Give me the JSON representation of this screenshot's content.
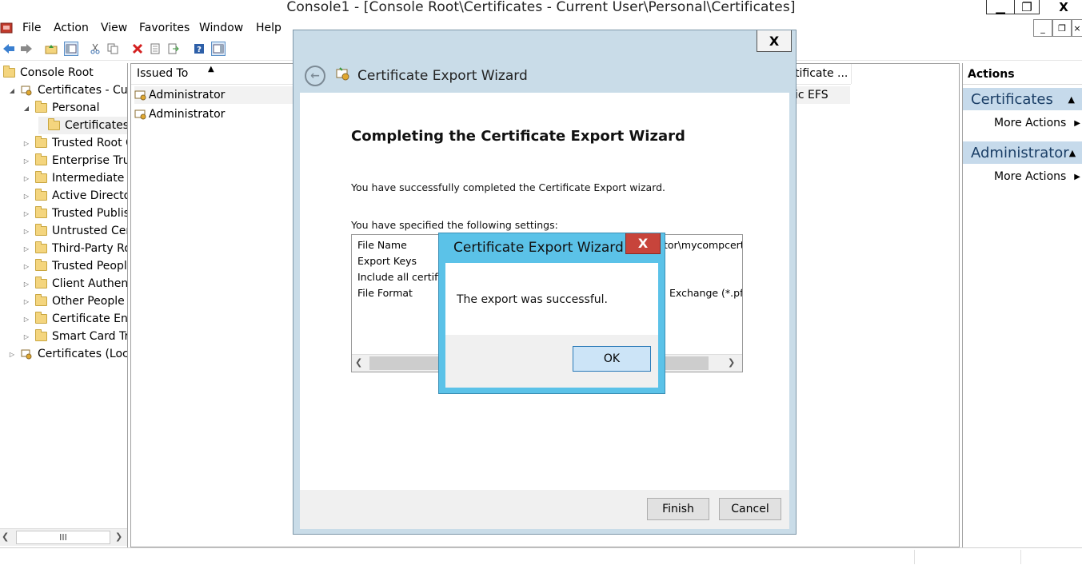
{
  "window": {
    "title": "Console1 - [Console Root\\Certificates - Current User\\Personal\\Certificates]",
    "minimize": "▁",
    "maximize": "❐",
    "close": "X"
  },
  "menu": {
    "items": [
      "File",
      "Action",
      "View",
      "Favorites",
      "Window",
      "Help"
    ],
    "mdi_minimize": "_",
    "mdi_restore": "❐",
    "mdi_close": "×"
  },
  "tree": {
    "items": [
      {
        "label": "Console Root",
        "level": 0,
        "arrow": "",
        "icon": "folder"
      },
      {
        "label": "Certificates - Curr",
        "level": 1,
        "arrow": "◢",
        "icon": "certstore"
      },
      {
        "label": "Personal",
        "level": 2,
        "arrow": "◢",
        "icon": "folder"
      },
      {
        "label": "Certificates",
        "level": 3,
        "arrow": "",
        "icon": "folder",
        "selected": true
      },
      {
        "label": "Trusted Root C",
        "level": 2,
        "arrow": "▷",
        "icon": "folder"
      },
      {
        "label": "Enterprise Trus",
        "level": 2,
        "arrow": "▷",
        "icon": "folder"
      },
      {
        "label": "Intermediate C",
        "level": 2,
        "arrow": "▷",
        "icon": "folder"
      },
      {
        "label": "Active Director",
        "level": 2,
        "arrow": "▷",
        "icon": "folder"
      },
      {
        "label": "Trusted Publish",
        "level": 2,
        "arrow": "▷",
        "icon": "folder"
      },
      {
        "label": "Untrusted Cert",
        "level": 2,
        "arrow": "▷",
        "icon": "folder"
      },
      {
        "label": "Third-Party Ro",
        "level": 2,
        "arrow": "▷",
        "icon": "folder"
      },
      {
        "label": "Trusted People",
        "level": 2,
        "arrow": "▷",
        "icon": "folder"
      },
      {
        "label": "Client Authenti",
        "level": 2,
        "arrow": "▷",
        "icon": "folder"
      },
      {
        "label": "Other People",
        "level": 2,
        "arrow": "▷",
        "icon": "folder"
      },
      {
        "label": "Certificate Enro",
        "level": 2,
        "arrow": "▷",
        "icon": "folder"
      },
      {
        "label": "Smart Card Tru",
        "level": 2,
        "arrow": "▷",
        "icon": "folder"
      },
      {
        "label": "Certificates (Loca",
        "level": 1,
        "arrow": "▷",
        "icon": "certstore"
      }
    ],
    "scroll_thumb": "III"
  },
  "list": {
    "col_issued_to": "Issued To",
    "col_sort_arrow": "▲",
    "col_template": "tificate ...",
    "rows": [
      {
        "issued_to": "Administrator",
        "template": "ic EFS"
      },
      {
        "issued_to": "Administrator",
        "template": ""
      }
    ]
  },
  "actions": {
    "title": "Actions",
    "sections": [
      {
        "label": "Certificates",
        "item": "More Actions"
      },
      {
        "label": "Administrator",
        "item": "More Actions"
      }
    ]
  },
  "wizard": {
    "close": "X",
    "title": "Certificate Export Wizard",
    "heading": "Completing the Certificate Export Wizard",
    "message": "You have successfully completed the Certificate Export wizard.",
    "settings_label": "You have specified the following settings:",
    "settings": [
      {
        "name": "File Name",
        "value": "tor\\mycompcert.p"
      },
      {
        "name": "Export Keys",
        "value": ""
      },
      {
        "name": "Include all certific",
        "value": ""
      },
      {
        "name": "File Format",
        "value": "Exchange (*.pfx"
      }
    ],
    "finish_label": "Finish",
    "cancel_label": "Cancel"
  },
  "msgbox": {
    "title": "Certificate Export Wizard",
    "close": "X",
    "text": "The export was successful.",
    "ok_label": "OK"
  }
}
